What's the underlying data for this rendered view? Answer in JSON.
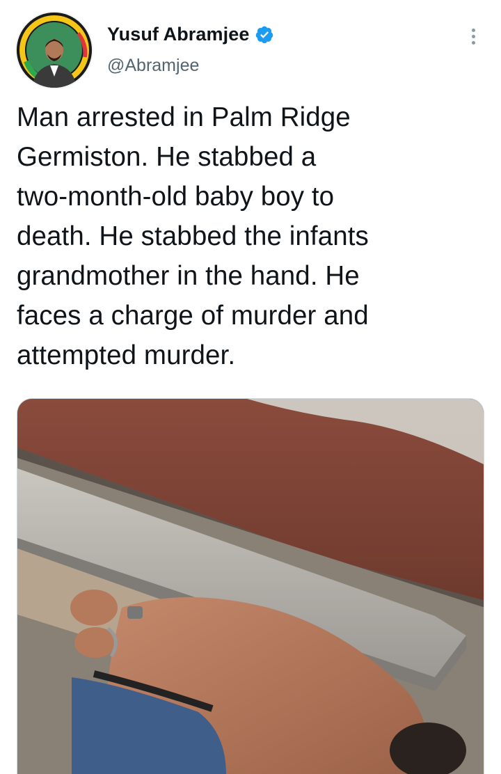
{
  "tweet": {
    "author": {
      "display_name": "Yusuf Abramjee",
      "handle": "@Abramjee",
      "verified": true,
      "avatar_icon": "profile-photo-avatar"
    },
    "text": "Man arrested in Palm Ridge\nGermiston. He stabbed a\ntwo-month-old baby boy to\ndeath. He stabbed the infants\ngrandmother in the hand. He\nfaces a charge of murder and\nattempted murder.",
    "media": {
      "icon": "photo-image",
      "description_hidden": true
    },
    "icons": {
      "verified": "verified-badge-icon",
      "more": "more-options-icon"
    },
    "colors": {
      "verified_blue": "#1d9bf0",
      "secondary_text": "#536471",
      "primary_text": "#0f1419"
    }
  }
}
